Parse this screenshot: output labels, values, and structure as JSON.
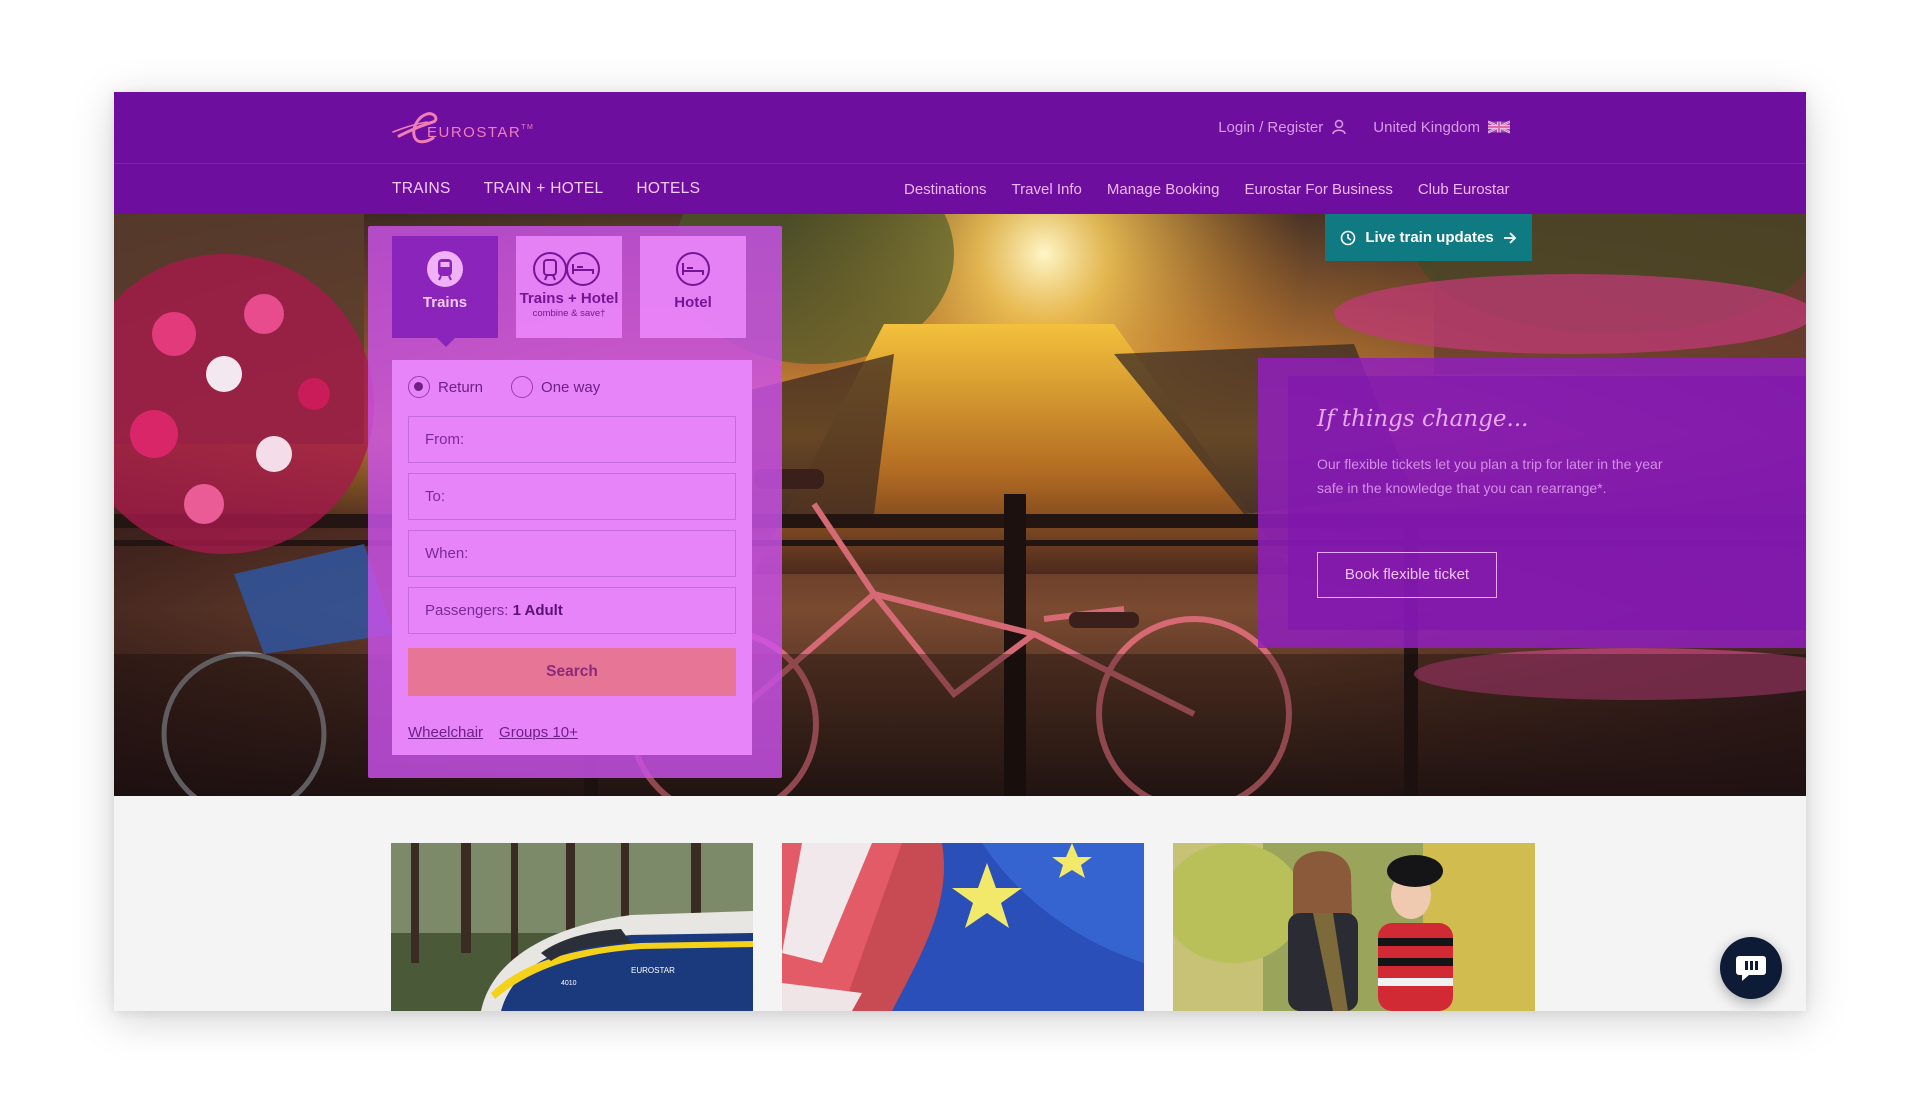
{
  "brand": {
    "name": "EUROSTAR",
    "trademark": "TM",
    "colors": {
      "primary": "#6d0e9e",
      "accent": "#e77596",
      "teal": "#107a82"
    }
  },
  "header": {
    "login_label": "Login / Register",
    "country_label": "United Kingdom",
    "icons": {
      "login": "user-icon",
      "country": "uk-flag-icon"
    }
  },
  "nav": {
    "main": [
      "TRAINS",
      "TRAIN + HOTEL",
      "HOTELS"
    ],
    "secondary": [
      "Destinations",
      "Travel Info",
      "Manage Booking",
      "Eurostar For Business",
      "Club Eurostar"
    ]
  },
  "live_updates": {
    "label": "Live train updates",
    "icons": [
      "clock-icon",
      "arrow-right-icon"
    ]
  },
  "booking": {
    "tabs": [
      {
        "label": "Trains",
        "sub": "",
        "icon": "train-icon",
        "active": true
      },
      {
        "label": "Trains + Hotel",
        "sub": "combine & save†",
        "icon": "train-bed-icon",
        "active": false
      },
      {
        "label": "Hotel",
        "sub": "",
        "icon": "bed-icon",
        "active": false
      }
    ],
    "trip_types": [
      {
        "label": "Return",
        "selected": true
      },
      {
        "label": "One way",
        "selected": false
      }
    ],
    "from_label": "From:",
    "to_label": "To:",
    "when_label": "When:",
    "passengers_label": "Passengers:",
    "passengers_value": "1 Adult",
    "search_label": "Search",
    "links": [
      "Wheelchair",
      "Groups 10+"
    ]
  },
  "promo": {
    "title": "If things change...",
    "text": "Our flexible tickets let you plan a trip for later in the year safe in the knowledge that you can rearrange*.",
    "button_label": "Book flexible ticket"
  },
  "cards": [
    {
      "image": "eurostar-train-photo",
      "train_number": "4010",
      "logo_text": "EUROSTAR"
    },
    {
      "image": "uk-eu-flags-photo"
    },
    {
      "image": "two-women-laughing-photo"
    }
  ],
  "chat": {
    "icon": "chat-bubble-icon"
  }
}
